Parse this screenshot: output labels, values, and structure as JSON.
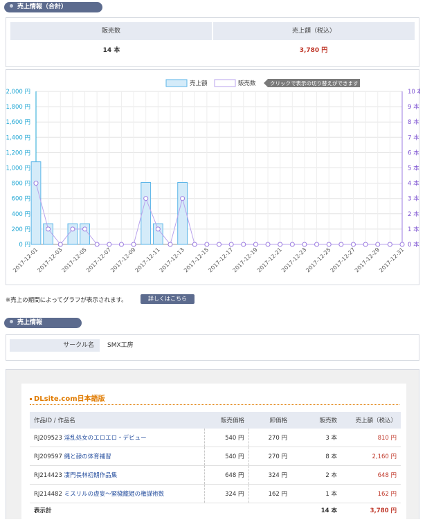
{
  "section1": {
    "title": "売上情報（合計）"
  },
  "summary": {
    "headers": [
      "販売数",
      "売上額（税込）"
    ],
    "sales_count": "14 本",
    "sales_amount": "3,780 円"
  },
  "chart_data": {
    "type": "bar",
    "legend": {
      "bar_label": "売上額",
      "line_label": "販売数",
      "tip": "クリックで表示の切り替えができます"
    },
    "categories": [
      "2017-12-01",
      "2017-12-02",
      "2017-12-03",
      "2017-12-04",
      "2017-12-05",
      "2017-12-06",
      "2017-12-07",
      "2017-12-08",
      "2017-12-09",
      "2017-12-10",
      "2017-12-11",
      "2017-12-12",
      "2017-12-13",
      "2017-12-14",
      "2017-12-15",
      "2017-12-16",
      "2017-12-17",
      "2017-12-18",
      "2017-12-19",
      "2017-12-20",
      "2017-12-21",
      "2017-12-22",
      "2017-12-23",
      "2017-12-24",
      "2017-12-25",
      "2017-12-26",
      "2017-12-27",
      "2017-12-28",
      "2017-12-29",
      "2017-12-30",
      "2017-12-31"
    ],
    "x_tick_labels": [
      "2017-12-01",
      "2017-12-03",
      "2017-12-05",
      "2017-12-07",
      "2017-12-09",
      "2017-12-11",
      "2017-12-13",
      "2017-12-15",
      "2017-12-17",
      "2017-12-19",
      "2017-12-21",
      "2017-12-23",
      "2017-12-25",
      "2017-12-27",
      "2017-12-29",
      "2017-12-31"
    ],
    "series": [
      {
        "name": "売上額",
        "axis": "left",
        "color": "#5bb5e8",
        "values": [
          1080,
          270,
          0,
          270,
          270,
          0,
          0,
          0,
          0,
          810,
          270,
          0,
          810,
          0,
          0,
          0,
          0,
          0,
          0,
          0,
          0,
          0,
          0,
          0,
          0,
          0,
          0,
          0,
          0,
          0,
          0
        ]
      },
      {
        "name": "販売数",
        "axis": "right",
        "color": "#9b7be0",
        "values": [
          4,
          1,
          0,
          1,
          1,
          0,
          0,
          0,
          0,
          3,
          1,
          0,
          3,
          0,
          0,
          0,
          0,
          0,
          0,
          0,
          0,
          0,
          0,
          0,
          0,
          0,
          0,
          0,
          0,
          0,
          0
        ]
      }
    ],
    "y_left_ticks": [
      "2,000 円",
      "1,800 円",
      "1,600 円",
      "1,400 円",
      "1,200 円",
      "1,000 円",
      "800 円",
      "600 円",
      "400 円",
      "200 円",
      "0 円"
    ],
    "y_right_ticks": [
      "10 本",
      "9 本",
      "8 本",
      "7 本",
      "6 本",
      "5 本",
      "4 本",
      "3 本",
      "2 本",
      "1 本",
      "0 本"
    ],
    "ylim_left": [
      0,
      2000
    ],
    "ylim_right": [
      0,
      10
    ]
  },
  "chart_note": "※売上の期間によってグラフが表示されます。",
  "detail_button": "詳しくはこちら",
  "section2": {
    "title": "売上情報"
  },
  "circle": {
    "label": "サークル名",
    "value": "SMX工房"
  },
  "dlsite": {
    "title": "DLsite.com日本語版",
    "headers": {
      "id_name": "作品ID / 作品名",
      "price": "販売価格",
      "wholesale": "卸価格",
      "count": "販売数",
      "sales": "売上額（税込）"
    },
    "rows": [
      {
        "id": "RJ209523",
        "name": "淫乱処女のエロエロ・デビュー",
        "price": "540 円",
        "wholesale": "270 円",
        "count": "3 本",
        "sales": "810 円"
      },
      {
        "id": "RJ209597",
        "name": "縄と隷の体育補習",
        "price": "540 円",
        "wholesale": "270 円",
        "count": "8 本",
        "sales": "2,160 円"
      },
      {
        "id": "RJ214423",
        "name": "凄門長林初期作品集",
        "price": "648 円",
        "wholesale": "324 円",
        "count": "2 本",
        "sales": "648 円"
      },
      {
        "id": "RJ214482",
        "name": "ミスリルの虚妄～緊穢籠姫の権謀術数",
        "price": "324 円",
        "wholesale": "162 円",
        "count": "1 本",
        "sales": "162 円"
      }
    ],
    "total": {
      "label": "表示計",
      "count": "14 本",
      "sales": "3,780 円"
    }
  }
}
